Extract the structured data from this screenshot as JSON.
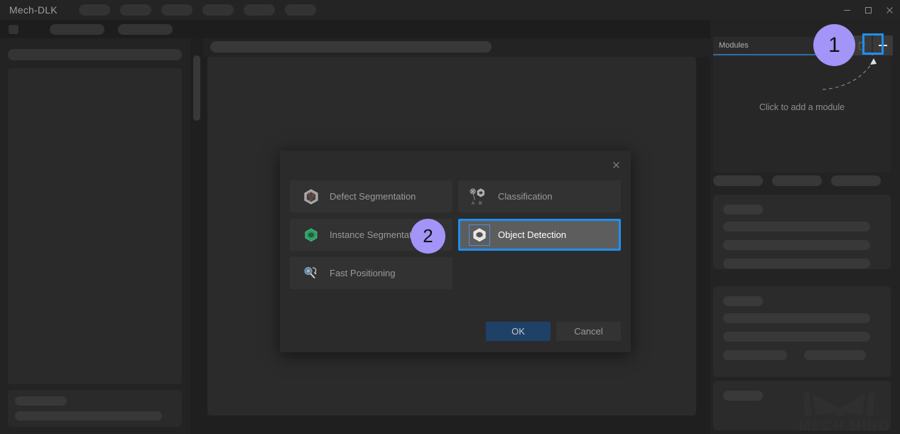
{
  "window": {
    "title": "Mech-DLK",
    "controls": [
      {
        "name": "minimize",
        "glyph": "minimize-icon"
      },
      {
        "name": "maximize",
        "glyph": "maximize-icon"
      },
      {
        "name": "close",
        "glyph": "close-icon"
      }
    ],
    "menu_placeholders": [
      44,
      44,
      44,
      44,
      44,
      44
    ],
    "toolbar2_placeholders": [
      77,
      77
    ]
  },
  "left_panel": {
    "top_bar_placeholder": true,
    "main_box_placeholder": true,
    "lower_box_placeholder": true
  },
  "center": {
    "toolbar_pill_placeholder": true,
    "canvas_placeholder": true
  },
  "right_panel": {
    "header": {
      "title": "Modules",
      "accent_color": "#2e6ea8"
    },
    "actions": [
      {
        "name": "delete-module",
        "icon": "trash-icon",
        "label": ""
      },
      {
        "name": "add-module",
        "icon": "plus-icon",
        "label": "+",
        "highlighted": true,
        "highlight_color": "#1e90f0"
      }
    ],
    "empty_hint": "Click to add a module",
    "trio_placeholders": [
      70,
      70,
      70
    ],
    "cards": [
      {
        "title_placeholder": true,
        "rows": [
          207,
          207,
          207
        ]
      },
      {
        "title_placeholder": true,
        "rows": [
          207,
          207
        ],
        "split_row": [
          90,
          90
        ]
      },
      {
        "title_placeholder": true,
        "rows": []
      }
    ],
    "watermark": "MECH MIND"
  },
  "dialog": {
    "close_icon": "close-icon",
    "modules": [
      {
        "label": "Defect Segmentation",
        "icon": "defect-segmentation-icon",
        "selected": false,
        "column": "left"
      },
      {
        "label": "Classification",
        "icon": "classification-icon",
        "selected": false,
        "column": "right"
      },
      {
        "label": "Instance Segmentation",
        "icon": "instance-segmentation-icon",
        "selected": false,
        "column": "left"
      },
      {
        "label": "Object Detection",
        "icon": "object-detection-icon",
        "selected": true,
        "column": "right"
      },
      {
        "label": "Fast Positioning",
        "icon": "fast-positioning-icon",
        "selected": false,
        "column": "left"
      }
    ],
    "ok_label": "OK",
    "cancel_label": "Cancel",
    "selection_color": "#1e90f0"
  },
  "annotations": {
    "badges": [
      {
        "number": "1",
        "target": "add-module-button"
      },
      {
        "number": "2",
        "target": "object-detection-item"
      }
    ],
    "badge_color": "#a394f7"
  }
}
